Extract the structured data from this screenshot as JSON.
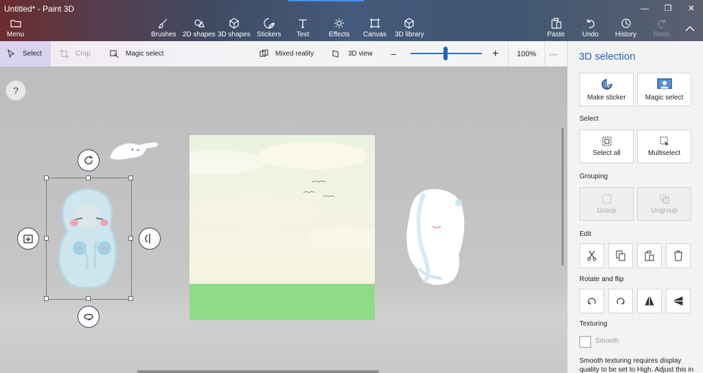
{
  "window": {
    "title": "Untitled* - Paint 3D"
  },
  "ribbon": {
    "menu": "Menu",
    "tools": [
      {
        "label": "Brushes",
        "icon": "brush-icon"
      },
      {
        "label": "2D shapes",
        "icon": "2d-shapes-icon"
      },
      {
        "label": "3D shapes",
        "icon": "3d-shapes-icon"
      },
      {
        "label": "Stickers",
        "icon": "stickers-icon"
      },
      {
        "label": "Text",
        "icon": "text-icon"
      },
      {
        "label": "Effects",
        "icon": "effects-icon"
      },
      {
        "label": "Canvas",
        "icon": "canvas-icon"
      },
      {
        "label": "3D library",
        "icon": "3d-library-icon"
      }
    ],
    "paste": "Paste",
    "undo": "Undo",
    "history": "History",
    "redo": "Redo"
  },
  "toolbar": {
    "select": "Select",
    "crop": "Crop",
    "magic_select": "Magic select",
    "mixed_reality": "Mixed reality",
    "view_3d": "3D view",
    "zoom_out": "−",
    "zoom_in": "+",
    "zoom_level": "100%",
    "zoom_fraction": 0.5,
    "more": "···"
  },
  "workspace": {
    "help": "?"
  },
  "panel": {
    "title": "3D selection",
    "make_sticker": "Make sticker",
    "magic_select": "Magic select",
    "select_section": "Select",
    "select_all": "Select all",
    "multiselect": "Multiselect",
    "grouping_section": "Grouping",
    "group": "Group",
    "ungroup": "Ungroup",
    "edit_section": "Edit",
    "rotate_section": "Rotate and flip",
    "texturing_section": "Texturing",
    "smooth": "Smooth",
    "smooth_note": "Smooth texturing requires display quality to be set to High. Adjust this in"
  },
  "colors": {
    "accent": "#2460b5",
    "canvas_grass": "#8fdb8a",
    "ribbon_bg": "#445a7a"
  }
}
